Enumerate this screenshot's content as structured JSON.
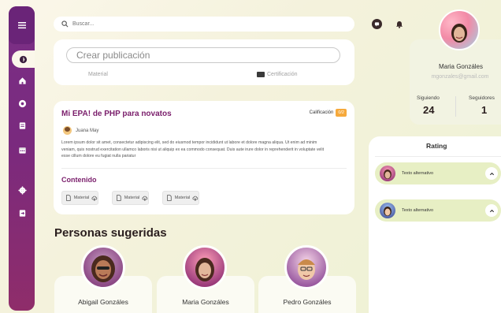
{
  "search": {
    "placeholder": "Buscar..."
  },
  "create_post": {
    "placeholder": "Crear publicación",
    "options": [
      "Material",
      "Certificación"
    ]
  },
  "post": {
    "title": "Mi EPA! de PHP para novatos",
    "grade_label": "Calificación",
    "grade_value": "0/2",
    "author": "Juana May",
    "body": "Lorem ipsum dolor sit amet, consectetur adipiscing elit, sed do eiusmod tempor incididunt ut labore et dolore magna aliqua. Ut enim ad minim veniam, quis nostrud exercitation ullamco laboris nisi ut aliquip ex ea commodo consequat. Duis aute irure dolor in reprehenderit in voluptate velit esse cillum dolore eu fugiat nulla pariatur",
    "content_heading": "Contenido",
    "materials": [
      "Material",
      "Material",
      "Material"
    ]
  },
  "suggested": {
    "title": "Personas sugeridas",
    "people": [
      {
        "name": "Abigail Gonzáles"
      },
      {
        "name": "Maria Gonzáles"
      },
      {
        "name": "Pedro Gonzáles"
      }
    ]
  },
  "profile": {
    "name": "Maria Gonzáles",
    "email": "mgonzales@gmail.com",
    "following_label": "Siguiendo",
    "following_value": "24",
    "followers_label": "Seguidores",
    "followers_value": "1"
  },
  "rating": {
    "title": "Rating",
    "items": [
      {
        "label": "Texto alternativo"
      },
      {
        "label": "Texto alternativo"
      }
    ]
  },
  "colors": {
    "sidebar": "#7b2f86",
    "accent_title": "#7a1e6b",
    "grade_badge": "#f6a93b",
    "rating_item": "#e7efc4"
  },
  "icons": {
    "sidebar": [
      "menu-icon",
      "explore-icon",
      "home-icon",
      "record-icon",
      "document-icon",
      "calendar-icon",
      "settings-icon",
      "logout-icon"
    ],
    "header": [
      "message-icon",
      "notification-icon"
    ]
  }
}
